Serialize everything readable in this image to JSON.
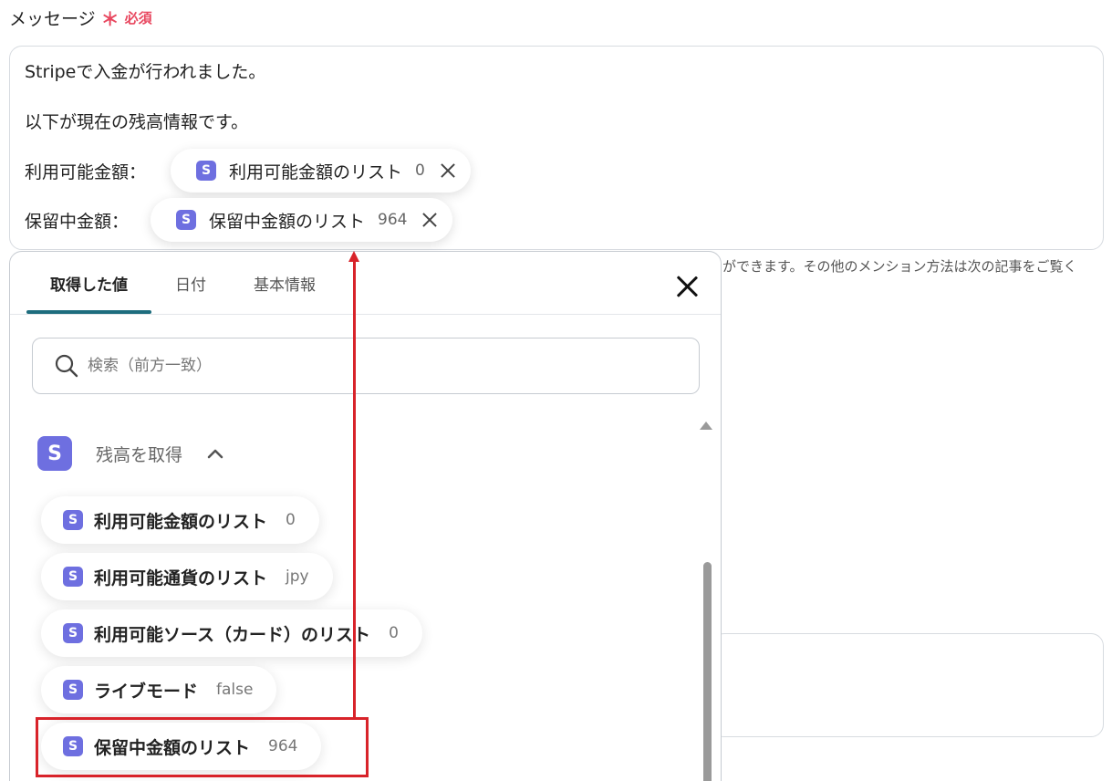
{
  "field": {
    "label": "メッセージ",
    "required_mark": "＊",
    "required_text": "必須"
  },
  "message": {
    "line1": "Stripeで入金が行われました。",
    "line2": "以下が現在の残高情報です。",
    "available_label": "利用可能金額：",
    "available_chip": {
      "label": "利用可能金額のリスト",
      "value": "0"
    },
    "pending_label": "保留中金額：",
    "pending_chip": {
      "label": "保留中金額のリスト",
      "value": "964"
    }
  },
  "help_text": "ができます。その他のメンション方法は次の記事をご覧く",
  "popup": {
    "tabs": [
      {
        "label": "取得した値",
        "active": true
      },
      {
        "label": "日付",
        "active": false
      },
      {
        "label": "基本情報",
        "active": false
      }
    ],
    "search_placeholder": "検索（前方一致）",
    "group": {
      "badge": "S",
      "title": "残高を取得"
    },
    "items": [
      {
        "label": "利用可能金額のリスト",
        "value": "0"
      },
      {
        "label": "利用可能通貨のリスト",
        "value": "jpy"
      },
      {
        "label": "利用可能ソース（カード）のリスト",
        "value": "0"
      },
      {
        "label": "ライブモード",
        "value": "false"
      },
      {
        "label": "保留中金額のリスト",
        "value": "964"
      }
    ]
  },
  "badge_letter": "S",
  "colors": {
    "required": "#e8475f",
    "stripe_badge": "#6e6fe0",
    "tab_underline": "#1e6d7e",
    "annotation_red": "#d8232a"
  }
}
